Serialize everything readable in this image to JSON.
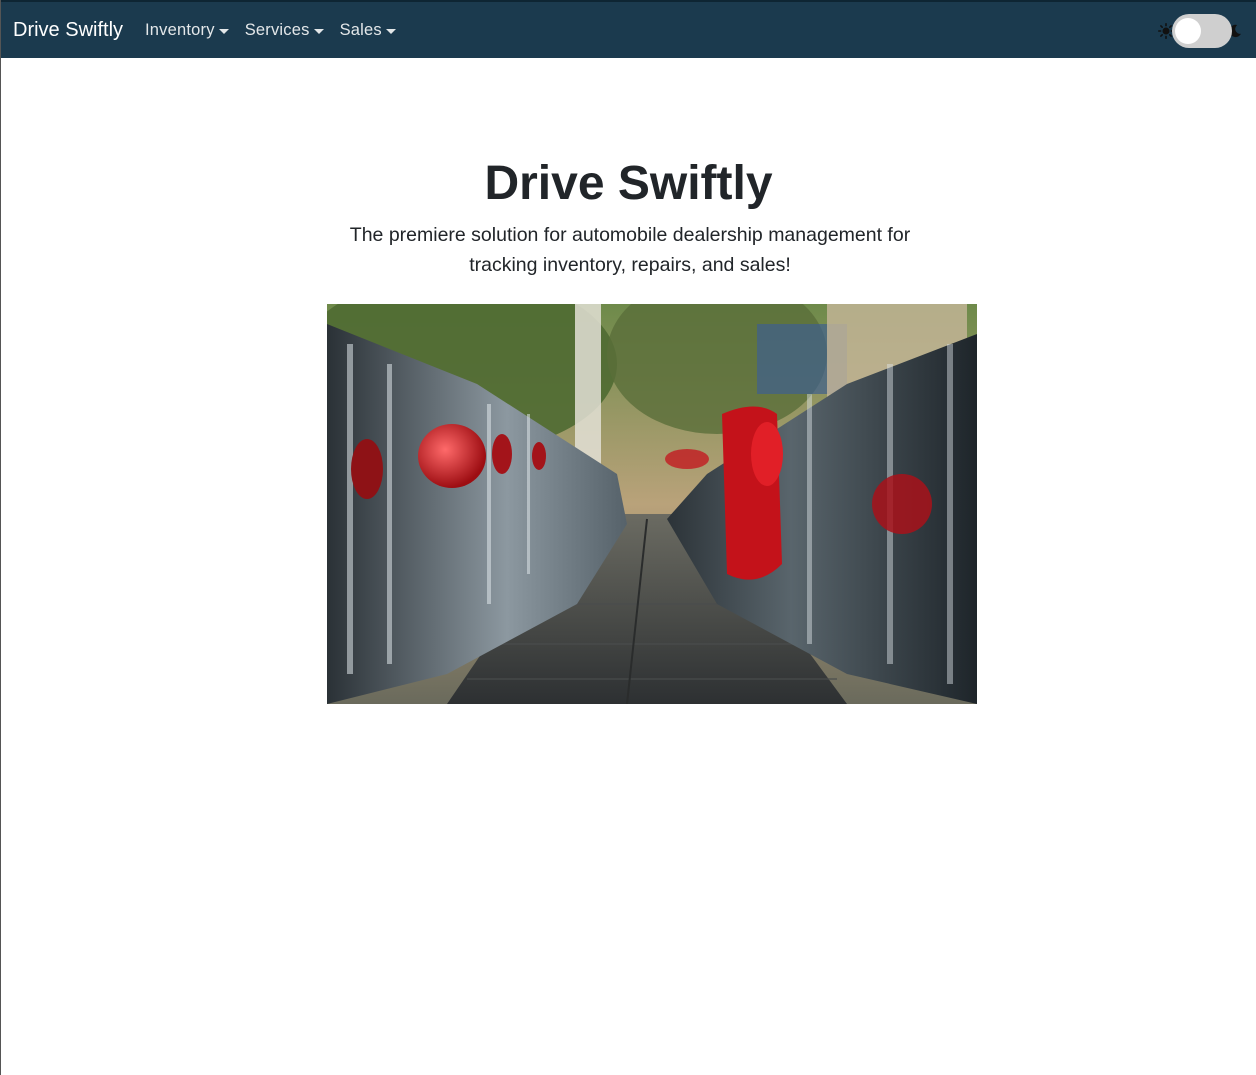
{
  "navbar": {
    "brand": "Drive Swiftly",
    "items": [
      {
        "label": "Inventory"
      },
      {
        "label": "Services"
      },
      {
        "label": "Sales"
      }
    ],
    "theme_toggle": {
      "state": "light"
    },
    "background_color": "#1b3a4e"
  },
  "hero": {
    "title": "Drive Swiftly",
    "lead": "The premiere solution for automobile dealership management for tracking inventory, repairs, and sales!",
    "image_alt_icon": "car-lot-photo"
  }
}
